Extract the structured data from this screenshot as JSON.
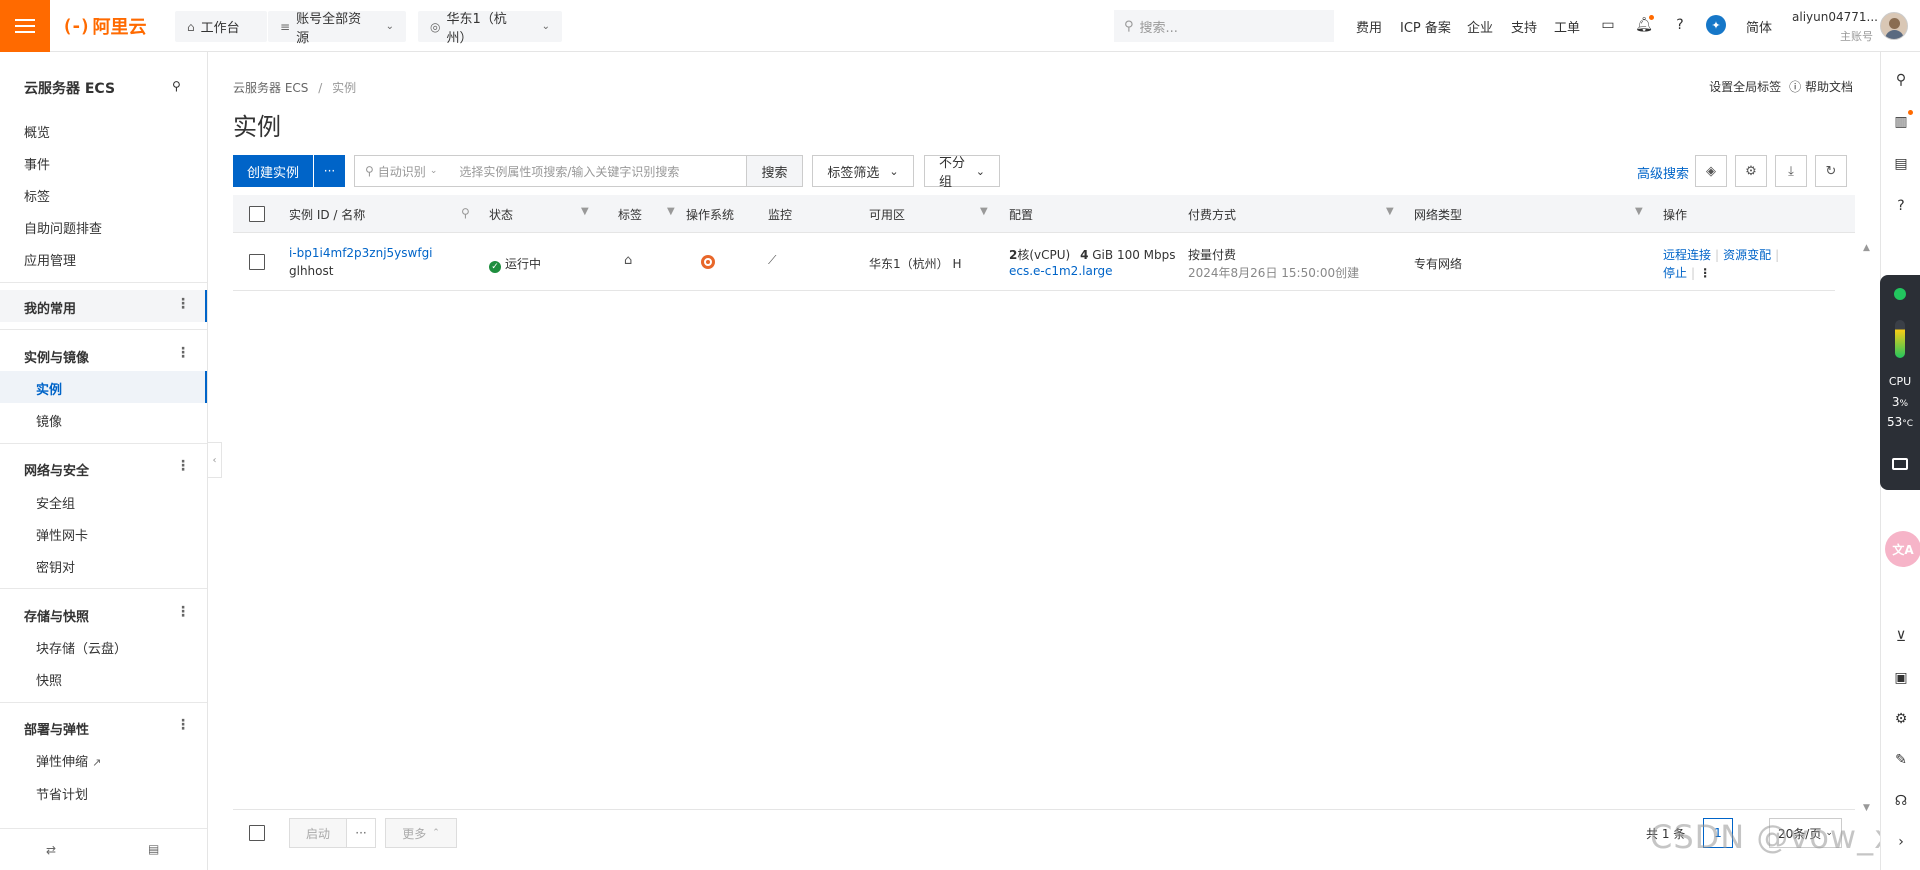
{
  "topbar": {
    "logo": "阿里云",
    "workbench": "工作台",
    "resource_group": "账号全部资源",
    "region": "华东1（杭州）",
    "search_placeholder": "搜索...",
    "links": [
      "费用",
      "ICP 备案",
      "企业",
      "支持",
      "工单"
    ],
    "language": "简体",
    "user_name": "aliyun04771...",
    "user_role": "主账号",
    "accent_color": "#ff6a00"
  },
  "sidebar": {
    "title": "云服务器 ECS",
    "items": [
      "概览",
      "事件",
      "标签",
      "自助问题排查",
      "应用管理"
    ],
    "favorites": "我的常用",
    "groups": [
      {
        "label": "实例与镜像",
        "items": [
          "实例",
          "镜像"
        ]
      },
      {
        "label": "网络与安全",
        "items": [
          "安全组",
          "弹性网卡",
          "密钥对"
        ]
      },
      {
        "label": "存储与快照",
        "items": [
          "块存储（云盘）",
          "快照"
        ]
      },
      {
        "label": "部署与弹性",
        "items": [
          "弹性伸缩",
          "节省计划"
        ]
      }
    ]
  },
  "main": {
    "breadcrumb": [
      "云服务器 ECS",
      "实例"
    ],
    "title": "实例",
    "top_links": [
      "设置全局标签",
      "帮助文档"
    ],
    "toolbar": {
      "create": "创建实例",
      "more": "···",
      "search_mode": "自动识别",
      "search_placeholder": "选择实例属性项搜索/输入关键字识别搜索",
      "search_button": "搜索",
      "tag_filter": "标签筛选",
      "group": "不分组",
      "advanced_search": "高级搜索"
    },
    "table": {
      "columns": [
        "实例 ID / 名称",
        "状态",
        "标签",
        "操作系统",
        "监控",
        "可用区",
        "配置",
        "付费方式",
        "网络类型",
        "操作"
      ],
      "rows": [
        {
          "id": "i-bp1i4mf2p3znj5yswfgi",
          "name": "glhhost",
          "status": "运行中",
          "zone": "华东1（杭州） H",
          "config_cpu": "2",
          "config_cpu_unit": "核(vCPU)",
          "config_mem": "4",
          "config_mem_unit": "GiB",
          "config_bw": "100 Mbps",
          "config_type": "ecs.e-c1m2.large",
          "billing": "按量付费",
          "created": "2024年8月26日 15:50:00创建",
          "network": "专有网络",
          "actions": [
            "远程连接",
            "资源变配",
            "停止"
          ]
        }
      ]
    },
    "footer": {
      "start": "启动",
      "more_dots": "···",
      "more": "更多",
      "total": "共 1 条",
      "page": "1",
      "page_size": "20条/页"
    }
  },
  "widget": {
    "cpu_label": "CPU",
    "cpu_value": "3",
    "cpu_unit": "%",
    "temp_value": "53",
    "temp_unit": "°C"
  },
  "watermark": "CSDN @vow_xh"
}
